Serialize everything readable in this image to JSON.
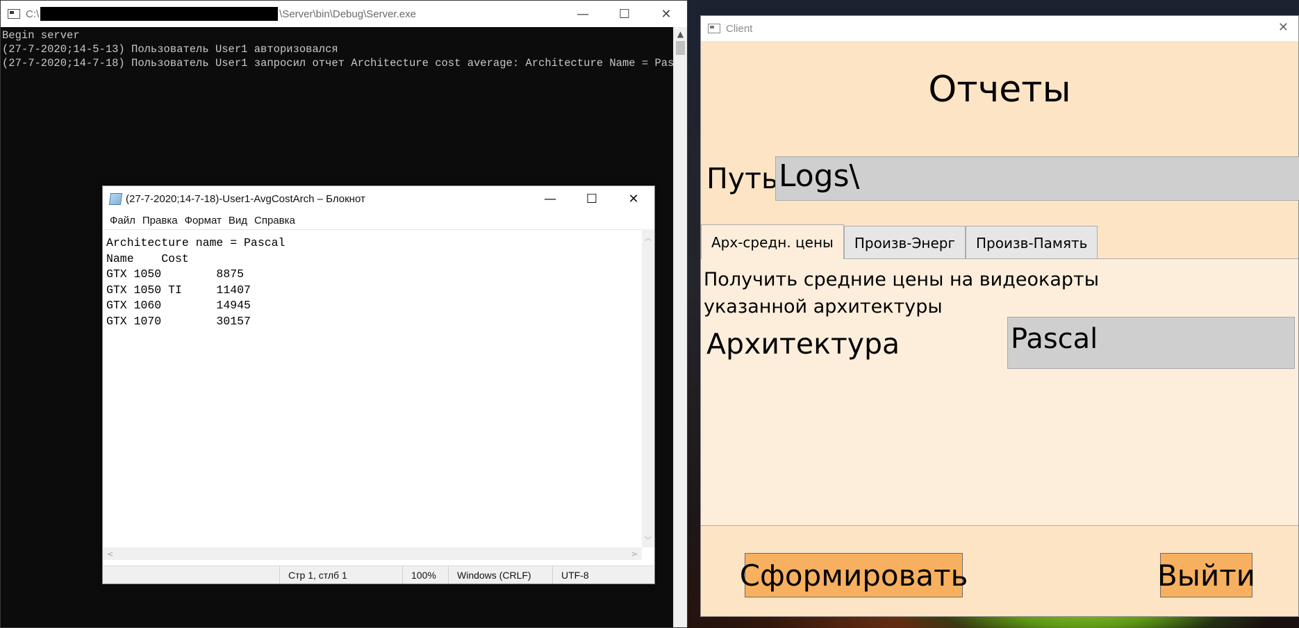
{
  "console": {
    "title_prefix": "C:\\",
    "title_suffix": "\\Server\\bin\\Debug\\Server.exe",
    "lines": [
      "Begin server",
      "(27-7-2020;14-5-13) Пользователь User1 авторизовался",
      "(27-7-2020;14-7-18) Пользователь User1 запросил отчет Architecture cost average: Architecture Name = Pascal"
    ],
    "controls": {
      "minimize": "—",
      "maximize": "☐",
      "close": "✕"
    }
  },
  "notepad": {
    "title": "(27-7-2020;14-7-18)-User1-AvgCostArch – Блокнот",
    "menu": [
      "Файл",
      "Правка",
      "Формат",
      "Вид",
      "Справка"
    ],
    "content_lines": [
      "Architecture name = Pascal",
      "Name    Cost",
      "GTX 1050        8875",
      "GTX 1050 TI     11407",
      "GTX 1060        14945",
      "GTX 1070        30157"
    ],
    "status": {
      "position": "Стр 1, стлб 1",
      "zoom": "100%",
      "line_endings": "Windows (CRLF)",
      "encoding": "UTF-8"
    },
    "controls": {
      "minimize": "—",
      "maximize": "☐",
      "close": "✕"
    }
  },
  "client": {
    "title": "Client",
    "close": "✕",
    "heading": "Отчеты",
    "path_label": "Путь",
    "path_value": "Logs\\",
    "tabs": [
      "Арх-средн. цены",
      "Произв-Энерг",
      "Произв-Память"
    ],
    "active_tab": 0,
    "description": "Получить средние цены на видеокарты указанной архитектуры",
    "arch_label": "Архитектура",
    "arch_value": "Pascal",
    "generate_button": "Сформировать",
    "exit_button": "Выйти",
    "colors": {
      "background": "#fde4c4",
      "panel": "#fdeedc",
      "input": "#cfcfcf",
      "button": "#f7b060"
    }
  }
}
